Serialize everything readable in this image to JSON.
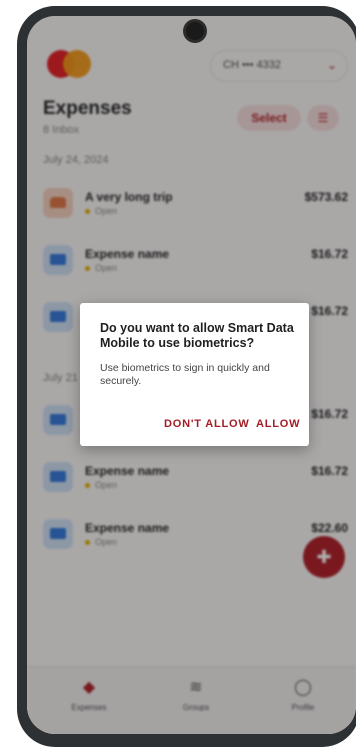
{
  "header": {
    "account_label": "CH ••• 4332"
  },
  "page": {
    "title": "Expenses",
    "subtitle": "8 Inbox",
    "select_label": "Select"
  },
  "groups": [
    {
      "date": "July 24, 2024",
      "items": [
        {
          "name": "A very long trip",
          "status": "Open",
          "amount": "$573.62",
          "icon": "car-icon"
        },
        {
          "name": "Expense name",
          "status": "Open",
          "amount": "$16.72",
          "icon": "card-icon"
        },
        {
          "name": "",
          "status": "",
          "amount": "$16.72",
          "icon": "card-icon"
        }
      ]
    },
    {
      "date": "July 21",
      "items": [
        {
          "name": "",
          "status": "",
          "amount": "$16.72",
          "icon": "card-icon"
        },
        {
          "name": "Expense name",
          "status": "Open",
          "amount": "$16.72",
          "icon": "card-icon"
        },
        {
          "name": "Expense name",
          "status": "Open",
          "amount": "$22.60",
          "icon": "card-icon"
        }
      ]
    }
  ],
  "nav": [
    {
      "label": "Expenses",
      "icon": "tag-icon"
    },
    {
      "label": "Groups",
      "icon": "layers-icon"
    },
    {
      "label": "Profile",
      "icon": "person-icon"
    }
  ],
  "dialog": {
    "title": "Do you want to allow Smart Data Mobile to use biometrics?",
    "body": "Use biometrics to sign in quickly and securely.",
    "deny_label": "DON'T ALLOW",
    "allow_label": "ALLOW"
  },
  "colors": {
    "accent": "#b3262e",
    "scrim": "rgba(0,0,0,0.32)"
  }
}
